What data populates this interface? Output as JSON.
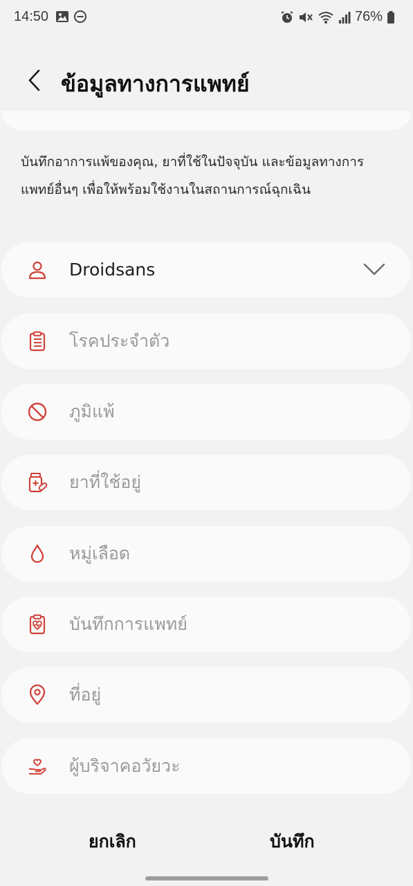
{
  "status_bar": {
    "time": "14:50",
    "battery": "76%"
  },
  "header": {
    "title": "ข้อมูลทางการแพทย์"
  },
  "intro": {
    "text": "บันทึกอาการแพ้ของคุณ, ยาที่ใช้ในปัจจุบัน และข้อมูลทางการแพทย์อื่นๆ เพื่อให้พร้อมใช้งานในสถานการณ์ฉุกเฉิน"
  },
  "fields": [
    {
      "label": "Droidsans",
      "icon": "person-icon",
      "filled": true
    },
    {
      "label": "โรคประจำตัว",
      "icon": "clipboard-list-icon",
      "filled": false
    },
    {
      "label": "ภูมิแพ้",
      "icon": "no-allergy-icon",
      "filled": false
    },
    {
      "label": "ยาที่ใช้อยู่",
      "icon": "medicine-bottle-icon",
      "filled": false
    },
    {
      "label": "หมู่เลือด",
      "icon": "blood-drop-icon",
      "filled": false
    },
    {
      "label": "บันทึกการแพทย์",
      "icon": "medical-clipboard-icon",
      "filled": false
    },
    {
      "label": "ที่อยู่",
      "icon": "location-pin-icon",
      "filled": false
    },
    {
      "label": "ผู้บริจาคอวัยวะ",
      "icon": "organ-donor-icon",
      "filled": false
    }
  ],
  "actions": {
    "cancel": "ยกเลิก",
    "save": "บันทึก"
  },
  "colors": {
    "accent": "#d1423a",
    "background": "#f2f2f2",
    "card": "#fafafa"
  }
}
